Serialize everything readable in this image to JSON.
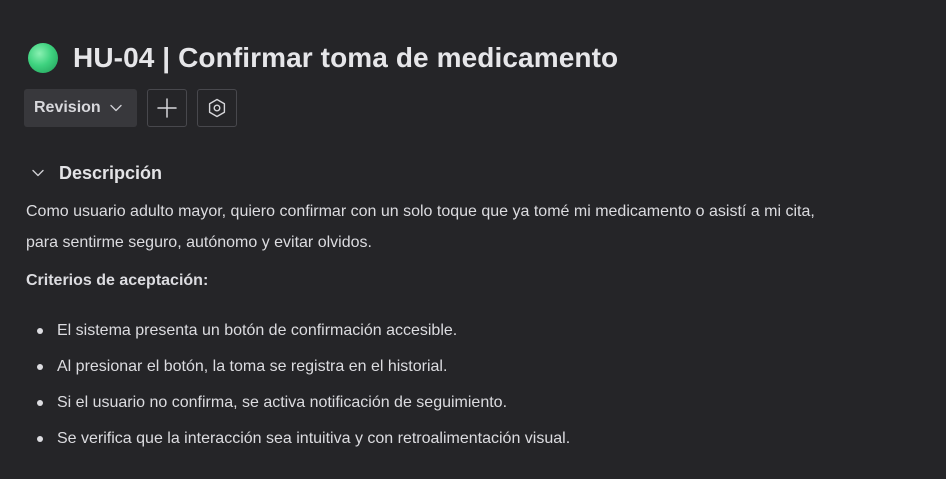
{
  "header": {
    "title": "HU-04 | Confirmar toma de medicamento",
    "status_color": "#3ed27f"
  },
  "toolbar": {
    "status_label": "Revision",
    "status_icon": "chevron-down-icon",
    "add_icon": "plus-icon",
    "settings_icon": "hexagon-settings-icon"
  },
  "description_section": {
    "title": "Descripción",
    "text_line_1": "Como usuario adulto mayor, quiero confirmar con un solo toque que ya tomé mi medicamento o asistí a mi cita,",
    "text_line_2": "para sentirme seguro, autónomo y evitar olvidos.",
    "criteria_title": "Criterios de aceptación:",
    "criteria": [
      "El sistema presenta un botón de confirmación accesible.",
      "Al presionar el botón, la toma se registra en el historial.",
      "Si el usuario no confirma, se activa notificación de seguimiento.",
      "Se verifica que la interacción sea intuitiva y con retroalimentación visual."
    ]
  }
}
